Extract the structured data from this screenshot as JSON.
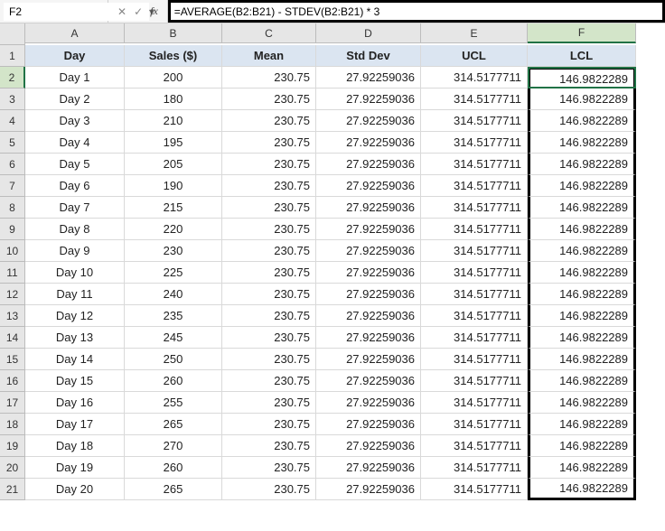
{
  "namebox": {
    "value": "F2"
  },
  "formula_bar": {
    "cancel_glyph": "✕",
    "confirm_glyph": "✓",
    "fx_glyph": "fx",
    "value": "=AVERAGE(B2:B21) - STDEV(B2:B21) * 3"
  },
  "columns": [
    "",
    "A",
    "B",
    "C",
    "D",
    "E",
    "F"
  ],
  "selected_column_index": 6,
  "selected_row": 2,
  "headers": {
    "A": "Day",
    "B": "Sales ($)",
    "C": "Mean",
    "D": "Std Dev",
    "E": "UCL",
    "F": "LCL"
  },
  "constants": {
    "mean": "230.75",
    "stddev": "27.92259036",
    "ucl": "314.5177711",
    "lcl": "146.9822289"
  },
  "rows": [
    {
      "n": 1,
      "day": "Day 1",
      "sales": "200"
    },
    {
      "n": 2,
      "day": "Day 2",
      "sales": "180"
    },
    {
      "n": 3,
      "day": "Day 3",
      "sales": "210"
    },
    {
      "n": 4,
      "day": "Day 4",
      "sales": "195"
    },
    {
      "n": 5,
      "day": "Day 5",
      "sales": "205"
    },
    {
      "n": 6,
      "day": "Day 6",
      "sales": "190"
    },
    {
      "n": 7,
      "day": "Day 7",
      "sales": "215"
    },
    {
      "n": 8,
      "day": "Day 8",
      "sales": "220"
    },
    {
      "n": 9,
      "day": "Day 9",
      "sales": "230"
    },
    {
      "n": 10,
      "day": "Day 10",
      "sales": "225"
    },
    {
      "n": 11,
      "day": "Day 11",
      "sales": "240"
    },
    {
      "n": 12,
      "day": "Day 12",
      "sales": "235"
    },
    {
      "n": 13,
      "day": "Day 13",
      "sales": "245"
    },
    {
      "n": 14,
      "day": "Day 14",
      "sales": "250"
    },
    {
      "n": 15,
      "day": "Day 15",
      "sales": "260"
    },
    {
      "n": 16,
      "day": "Day 16",
      "sales": "255"
    },
    {
      "n": 17,
      "day": "Day 17",
      "sales": "265"
    },
    {
      "n": 18,
      "day": "Day 18",
      "sales": "270"
    },
    {
      "n": 19,
      "day": "Day 19",
      "sales": "260"
    },
    {
      "n": 20,
      "day": "Day 20",
      "sales": "265"
    }
  ]
}
